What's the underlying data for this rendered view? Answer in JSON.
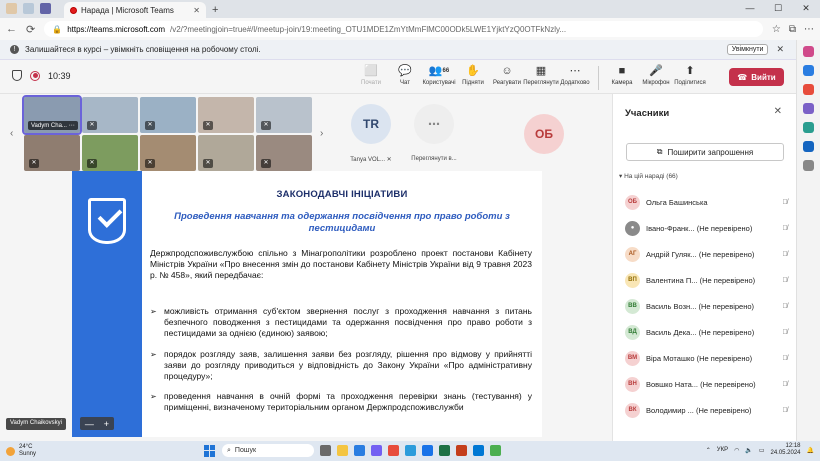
{
  "browser": {
    "tab_title": "Нарада | Microsoft Teams",
    "tab_close": "✕",
    "new_tab": "+",
    "url_host": "https://teams.microsoft.com",
    "url_path": "/v2/?meetingjoin=true#/l/meetup-join/19:meeting_OTU1MDE1ZmYtMmFlMC00ODk5LWE1YjktYzQ0OTFkNzly...",
    "window_controls": [
      "—",
      "☐",
      "✕"
    ],
    "nav": [
      "←",
      "⟳"
    ]
  },
  "notification": {
    "message": "Залишайтеся в курсі – увімкніть сповіщення на робочому столі.",
    "button": "Увімкнути",
    "close": "✕"
  },
  "toolbar": {
    "timer": "10:39",
    "tools": [
      {
        "icon": "⬜",
        "label": "Почати",
        "dim": true
      },
      {
        "icon": "💬",
        "label": "Чат"
      },
      {
        "icon": "👥",
        "label": "Користувачі",
        "count": "66"
      },
      {
        "icon": "✋",
        "label": "Підняти"
      },
      {
        "icon": "☺",
        "label": "Реагувати"
      },
      {
        "icon": "▦",
        "label": "Переглянути"
      },
      {
        "icon": "⋯",
        "label": "Додатково"
      }
    ],
    "devices": [
      {
        "icon": "■",
        "label": "Камера"
      },
      {
        "icon": "🎤",
        "label": "Мікрофон"
      },
      {
        "icon": "⬆",
        "label": "Поділитися"
      }
    ],
    "leave_label": "Вийти"
  },
  "gallery": {
    "active_name": "Vadym Cha...",
    "active_more": "⋯",
    "mic_off": "✕",
    "tiles": [
      "#8a9bb0",
      "#a7b7c7",
      "#9bb1c5",
      "#c4b6ab",
      "#b9c2cc",
      "#8f7d70",
      "#7d9c5f",
      "#a48c72",
      "#b0a899",
      "#9a8a80"
    ],
    "prev": "‹",
    "next": "›"
  },
  "participants_strip": [
    {
      "initials": "TR",
      "name": "Tanya VOL...",
      "bg": "#dbe4f0",
      "fg": "#30476e"
    },
    {
      "initials": "⋯",
      "name": "Переглянути в...",
      "bg": "#eeeeee",
      "fg": "#888888"
    },
    {
      "initials": "ОБ",
      "name": "",
      "bg": "#f5d1d1",
      "fg": "#b83b3b"
    }
  ],
  "slide": {
    "title": "ЗАКОНОДАВЧІ ІНІЦІАТИВИ",
    "subtitle": "Проведення навчання та одержання посвідчення про право роботи з пестицидами",
    "intro": "Держпродспоживслужбою спільно з Мінагрополітики розроблено проект постанови Кабінету Міністрів України «Про внесення змін до постанови Кабінету Міністрів України від 9 травня 2023 р. № 458», який передбачає:",
    "bullets": [
      "можливість отримання суб'єктом звернення послуг з проходження навчання з питань безпечного поводження з пестицидами та одержання посвідчення про право роботи з пестицидами за однією (єдиною) заявою;",
      "порядок розгляду заяв, залишення заяви без розгляду, рішення про відмову у прийнятті заяви до розгляду приводиться у відповідність до Закону України «Про адміністративну процедуру»;",
      "проведення навчання в очній формі та проходження перевірки знань (тестування) у приміщенні, визначеному територіальним органом Держпродспоживслужби"
    ]
  },
  "presenter_name": "Vadym Chaikovskyi",
  "zoom": {
    "minus": "—",
    "plus": "+"
  },
  "panel": {
    "title": "Учасники",
    "close": "✕",
    "share_label": "Поширити запрошення",
    "section_label": "На цій нараді (66)",
    "people": [
      {
        "initials": "ОБ",
        "name": "Ольга Башинська",
        "bg": "#f5d1d1",
        "fg": "#b83b3b"
      },
      {
        "initials": "",
        "name": "Івано-Франк... (Не перевірено)",
        "bg": "#8a8a8a",
        "fg": "#ffffff"
      },
      {
        "initials": "АГ",
        "name": "Андрій Гуляк... (Не перевірено)",
        "bg": "#f7dcc7",
        "fg": "#a8561d"
      },
      {
        "initials": "ВП",
        "name": "Валентина П... (Не перевірено)",
        "bg": "#f9e6b5",
        "fg": "#8f6b00"
      },
      {
        "initials": "ВВ",
        "name": "Василь Возн... (Не перевірено)",
        "bg": "#d4e9d4",
        "fg": "#2f7a32"
      },
      {
        "initials": "ВД",
        "name": "Василь Дека... (Не перевірено)",
        "bg": "#d4e9d4",
        "fg": "#2f7a32"
      },
      {
        "initials": "ВМ",
        "name": "Віра Моташко (Не перевірено)",
        "bg": "#f5d1d1",
        "fg": "#b83b3b"
      },
      {
        "initials": "ВН",
        "name": "Вовшко Ната... (Не перевірено)",
        "bg": "#f5d1d1",
        "fg": "#b83b3b"
      },
      {
        "initials": "ВК",
        "name": "Володимир ... (Не перевірено)",
        "bg": "#f5d1d1",
        "fg": "#b83b3b"
      }
    ]
  },
  "taskbar": {
    "temp": "24°C",
    "weather": "Sunny",
    "search_placeholder": "Пошук",
    "lang": "УКР",
    "time": "12:18",
    "date": "24.05.2024"
  }
}
